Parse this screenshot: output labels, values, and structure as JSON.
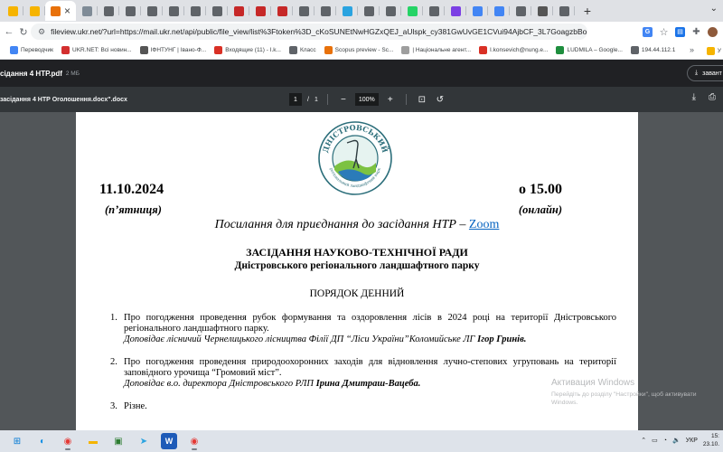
{
  "browser": {
    "tabs": [
      {
        "icon": "drive-folder-icon",
        "color": "#f6b400"
      },
      {
        "icon": "folder-icon",
        "color": "#f6b400"
      },
      {
        "icon": "fileview-icon",
        "color": "#e8710a",
        "active": true
      },
      {
        "icon": "file-icon",
        "color": "#7f8b97"
      },
      {
        "icon": "globe-icon",
        "color": "#5f6368"
      },
      {
        "icon": "globe-icon",
        "color": "#5f6368"
      },
      {
        "icon": "globe-icon",
        "color": "#5f6368"
      },
      {
        "icon": "globe-icon",
        "color": "#5f6368"
      },
      {
        "icon": "globe-icon",
        "color": "#5f6368"
      },
      {
        "icon": "globe-icon",
        "color": "#5f6368"
      },
      {
        "icon": "zoom-icon",
        "color": "#c62828"
      },
      {
        "icon": "zoom-icon",
        "color": "#c62828"
      },
      {
        "icon": "zoom-icon",
        "color": "#c62828"
      },
      {
        "icon": "globe-icon",
        "color": "#5f6368"
      },
      {
        "icon": "chrome-icon",
        "color": "#5f6368"
      },
      {
        "icon": "telegram-icon",
        "color": "#2aa3e0"
      },
      {
        "icon": "globe-icon",
        "color": "#5f6368"
      },
      {
        "icon": "globe-icon",
        "color": "#5f6368"
      },
      {
        "icon": "whatsapp-icon",
        "color": "#25d366"
      },
      {
        "icon": "globe-icon",
        "color": "#5f6368"
      },
      {
        "icon": "docs-icon",
        "color": "#7b3fe4"
      },
      {
        "icon": "translate-icon",
        "color": "#4285f4"
      },
      {
        "icon": "docs-icon",
        "color": "#4285f4"
      },
      {
        "icon": "globe-icon",
        "color": "#5f6368"
      },
      {
        "icon": "crest-icon",
        "color": "#555555"
      },
      {
        "icon": "globe-icon",
        "color": "#5f6368"
      }
    ],
    "tab_close": "×",
    "new_tab": "+",
    "url": "fileview.ukr.net/?url=https://mail.ukr.net/api/public/file_view/list%3Ftoken%3D_cKoSUNEtNwHGZxQEJ_aUlspk_cy381GwUvGE1CVui94AjbCF_3L7GoagzbBo_Ya5BStdQ0zxnmyBRZc...",
    "bookmarks": [
      {
        "label": "Переводчик",
        "icon": "translate-icon",
        "color": "#4285f4"
      },
      {
        "label": "UKR.NET: Всі новин...",
        "icon": "ukrnet-icon",
        "color": "#d32f2f"
      },
      {
        "label": "ІФНТУНГ | Івано-Ф...",
        "icon": "crest-icon",
        "color": "#555555"
      },
      {
        "label": "Входящие (11) - I.k...",
        "icon": "gmail-icon",
        "color": "#d93025"
      },
      {
        "label": "Класс",
        "icon": "globe-icon",
        "color": "#5f6368"
      },
      {
        "label": "Scopus preview - Sc...",
        "icon": "scopus-icon",
        "color": "#e8710a"
      },
      {
        "label": "| Національне агент...",
        "icon": "agency-icon",
        "color": "#9e9e9e"
      },
      {
        "label": "I.konsevich@nung.e...",
        "icon": "gmail-icon",
        "color": "#d93025"
      },
      {
        "label": "LUDMILA – Google...",
        "icon": "drive-icon",
        "color": "#1e8e3e"
      },
      {
        "label": "194.44.112.1",
        "icon": "globe-icon",
        "color": "#5f6368"
      }
    ],
    "bookmarks_more": "»",
    "bookmarks_end": "У"
  },
  "viewer": {
    "file_title": "сідання 4 НТР.pdf",
    "file_size": "2 МБ",
    "download_label": "завант"
  },
  "pdf_toolbar": {
    "doc_name": "засідання 4 НТР Оголошення.docx\".docx",
    "page_current": "1",
    "page_separator": "/",
    "page_total": "1",
    "zoom_out": "−",
    "zoom": "100%",
    "zoom_in": "+"
  },
  "document": {
    "logo_text": "ДНІСТРОВСЬКИЙ",
    "logo_subtext": "регіональний ландшафтний парк",
    "date": "11.10.2024",
    "day_of_week": "(п’ятниця)",
    "time": "о 15.00",
    "mode": "(онлайн)",
    "link_prefix": "Посилання для приєднання до засідання НТР – ",
    "link_text": "Zoom",
    "heading_council": "ЗАСІДАННЯ НАУКОВО-ТЕХНІЧНОЇ РАДИ",
    "heading_park": "Дністровського регіонального ландшафтного парку",
    "heading_agenda": "ПОРЯДОК ДЕННИЙ",
    "items": [
      {
        "num": "1.",
        "text": "Про погодження проведення рубок формування та оздоровлення лісів в 2024 році на території Дністровського регіонального ландшафтного парку.",
        "reporter_prefix": "Доповідає лісничий Чернелицького лісництва Філії ДП “Ліси України”Коломийське ЛГ ",
        "reporter_name": "Ігор Гринів."
      },
      {
        "num": "2.",
        "text": "Про погодження проведення природоохоронних заходів для відновлення лучно-степових угруповань на території заповідного урочища “Громовий міст”.",
        "reporter_prefix": "Доповідає в.о. директора Дністровського РЛП ",
        "reporter_name": "Ірина Дмитраш-Вацеба."
      },
      {
        "num": "3.",
        "text": "Різне.",
        "reporter_prefix": "",
        "reporter_name": ""
      }
    ]
  },
  "windows_activation": {
    "title": "Активация Windows",
    "subtitle": "Перейдіть до розділу \"Настройки\", щоб активувати Windows."
  },
  "taskbar": {
    "icons": [
      {
        "name": "windows-start-icon",
        "glyph": "⊞",
        "color": "#0078d4"
      },
      {
        "name": "edge-icon",
        "glyph": "◐",
        "color": "#0c8ee4"
      },
      {
        "name": "chrome-icon",
        "glyph": "◉",
        "color": "#e53935"
      },
      {
        "name": "file-explorer-icon",
        "glyph": "▬",
        "color": "#f4b400"
      },
      {
        "name": "photos-icon",
        "glyph": "▣",
        "color": "#2e7d32"
      },
      {
        "name": "telegram-icon",
        "glyph": "➤",
        "color": "#2aa3e0"
      },
      {
        "name": "word-icon",
        "glyph": "W",
        "color": "#1e5bb8"
      },
      {
        "name": "chrome-icon",
        "glyph": "◉",
        "color": "#e53935"
      }
    ],
    "lang": "УКР",
    "time": "15:",
    "date": "23.10."
  }
}
